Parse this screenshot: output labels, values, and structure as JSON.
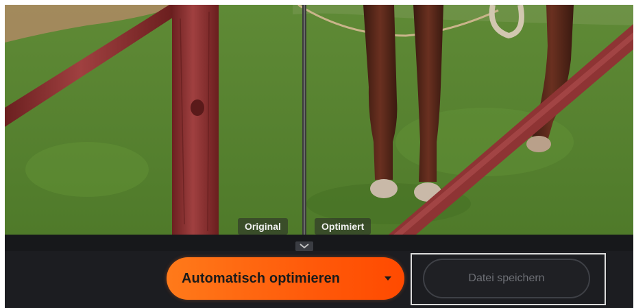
{
  "compare": {
    "left_label": "Original",
    "right_label": "Optimiert"
  },
  "toolbar": {
    "auto_button_label": "Automatisch optimieren",
    "save_button_label": "Datei speichern"
  },
  "colors": {
    "accent_orange": "#ff6a10",
    "toolbar_bg": "#1c1d21",
    "disabled_text": "#6e7076"
  },
  "icons": {
    "collapse": "chevron-down-icon",
    "dropdown": "caret-down-icon"
  }
}
